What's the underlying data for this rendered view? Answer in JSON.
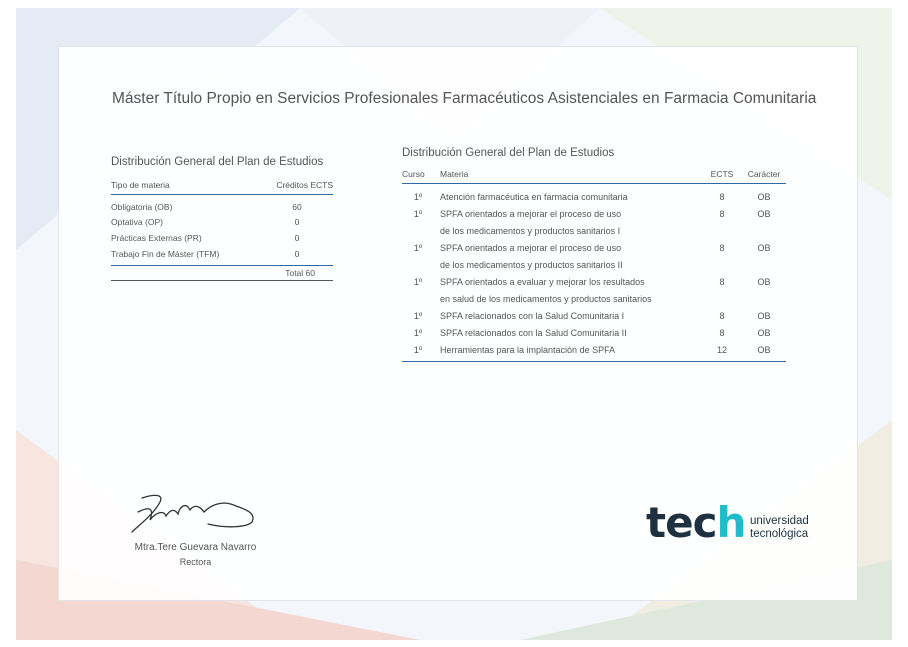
{
  "colors": {
    "accent_blue": "#2d6aa6",
    "logo_dark": "#1e3140",
    "logo_teal": "#1fbcc9"
  },
  "document": {
    "title": "Máster Título Propio en Servicios Profesionales Farmacéuticos Asistenciales en Farmacia Comunitaria"
  },
  "summary": {
    "heading": "Distribución General del Plan de Estudios",
    "col_type": "Tipo de materia",
    "col_credits": "Créditos ECTS",
    "rows": [
      {
        "name": "Obligatoria (OB)",
        "value": "60"
      },
      {
        "name": "Optativa (OP)",
        "value": "0"
      },
      {
        "name": "Prácticas Externas (PR)",
        "value": "0"
      },
      {
        "name": "Trabajo Fin de Máster (TFM)",
        "value": "0"
      }
    ],
    "total": "Total 60"
  },
  "plan": {
    "heading": "Distribución General del Plan de Estudios",
    "col_curso": "Curso",
    "col_materia": "Materia",
    "col_ects": "ECTS",
    "col_caracter": "Carácter",
    "rows": [
      {
        "curso": "1º",
        "materia": "Atención farmacéutica en farmacia comunitaria",
        "materia2": "",
        "ects": "8",
        "caracter": "OB"
      },
      {
        "curso": "1º",
        "materia": "SPFA orientados a mejorar el proceso de uso",
        "materia2": "de los medicamentos y productos sanitarios I",
        "ects": "8",
        "caracter": "OB"
      },
      {
        "curso": "1º",
        "materia": "SPFA orientados a mejorar el proceso de uso",
        "materia2": "de los medicamentos y productos sanitarios II",
        "ects": "8",
        "caracter": "OB"
      },
      {
        "curso": "1º",
        "materia": "SPFA orientados a evaluar y mejorar los resultados",
        "materia2": "en salud de los medicamentos y productos sanitarios",
        "ects": "8",
        "caracter": "OB"
      },
      {
        "curso": "1º",
        "materia": "SPFA relacionados con la Salud Comunitaria I",
        "materia2": "",
        "ects": "8",
        "caracter": "OB"
      },
      {
        "curso": "1º",
        "materia": "SPFA relacionados con la Salud Comunitaria II",
        "materia2": "",
        "ects": "8",
        "caracter": "OB"
      },
      {
        "curso": "1º",
        "materia": "Herramientas para la implantación de SPFA",
        "materia2": "",
        "ects": "12",
        "caracter": "OB"
      }
    ]
  },
  "signatory": {
    "name": "Mtra.Tere Guevara Navarro",
    "role": "Rectora"
  },
  "logo": {
    "word_prefix": "tec",
    "word_h": "h",
    "line1": "universidad",
    "line2": "tecnológica"
  }
}
